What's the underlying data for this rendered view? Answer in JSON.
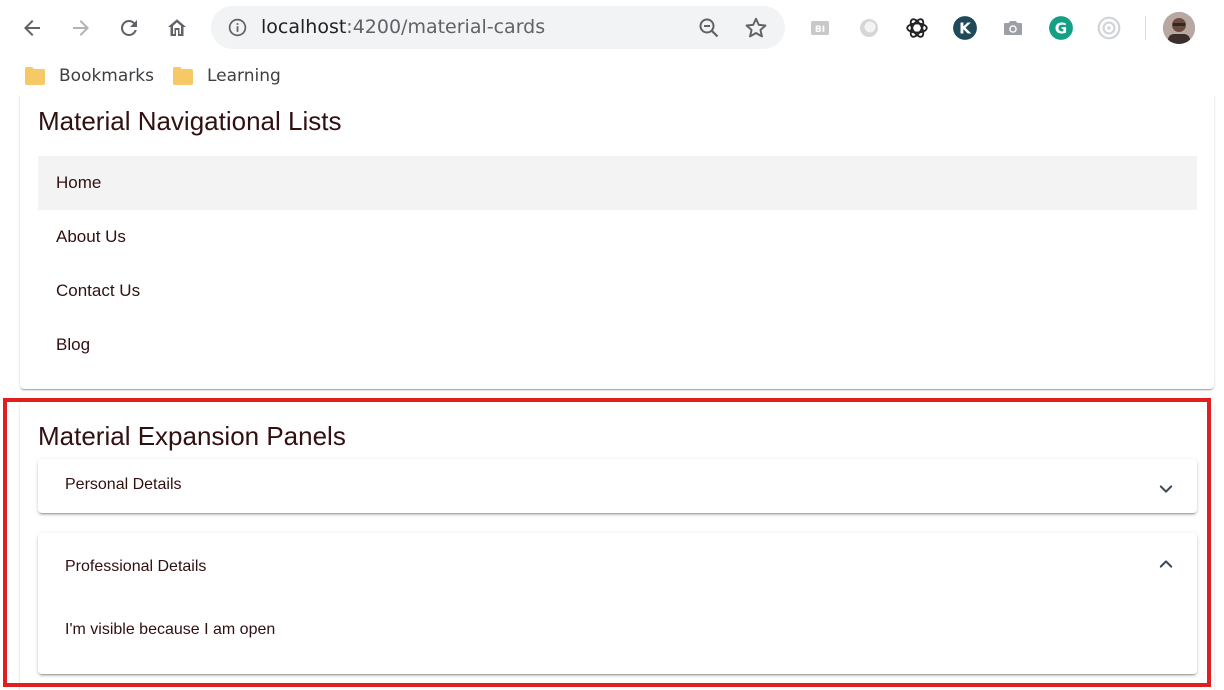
{
  "browser": {
    "url_host": "localhost",
    "url_path": ":4200/material-cards",
    "bookmarks": [
      {
        "label": "Bookmarks"
      },
      {
        "label": "Learning"
      }
    ],
    "extension_icons": [
      "bi-extension-icon",
      "circle-extension-icon",
      "openai-extension-icon",
      "k-extension-icon",
      "camera-extension-icon",
      "grammarly-extension-icon",
      "target-extension-icon"
    ]
  },
  "nav_card": {
    "title": "Material Navigational Lists",
    "items": [
      {
        "label": "Home",
        "active": true
      },
      {
        "label": "About Us"
      },
      {
        "label": "Contact Us"
      },
      {
        "label": "Blog"
      }
    ]
  },
  "expansion_card": {
    "title": "Material Expansion Panels",
    "panels": [
      {
        "title": "Personal Details",
        "expanded": false
      },
      {
        "title": "Professional Details",
        "expanded": true,
        "body": "I'm visible because I am open"
      }
    ]
  },
  "colors": {
    "accent": "#1a73e8",
    "highlight_border": "#e02020",
    "heading_text": "#311010",
    "active_item_bg": "#f3f3f3"
  }
}
